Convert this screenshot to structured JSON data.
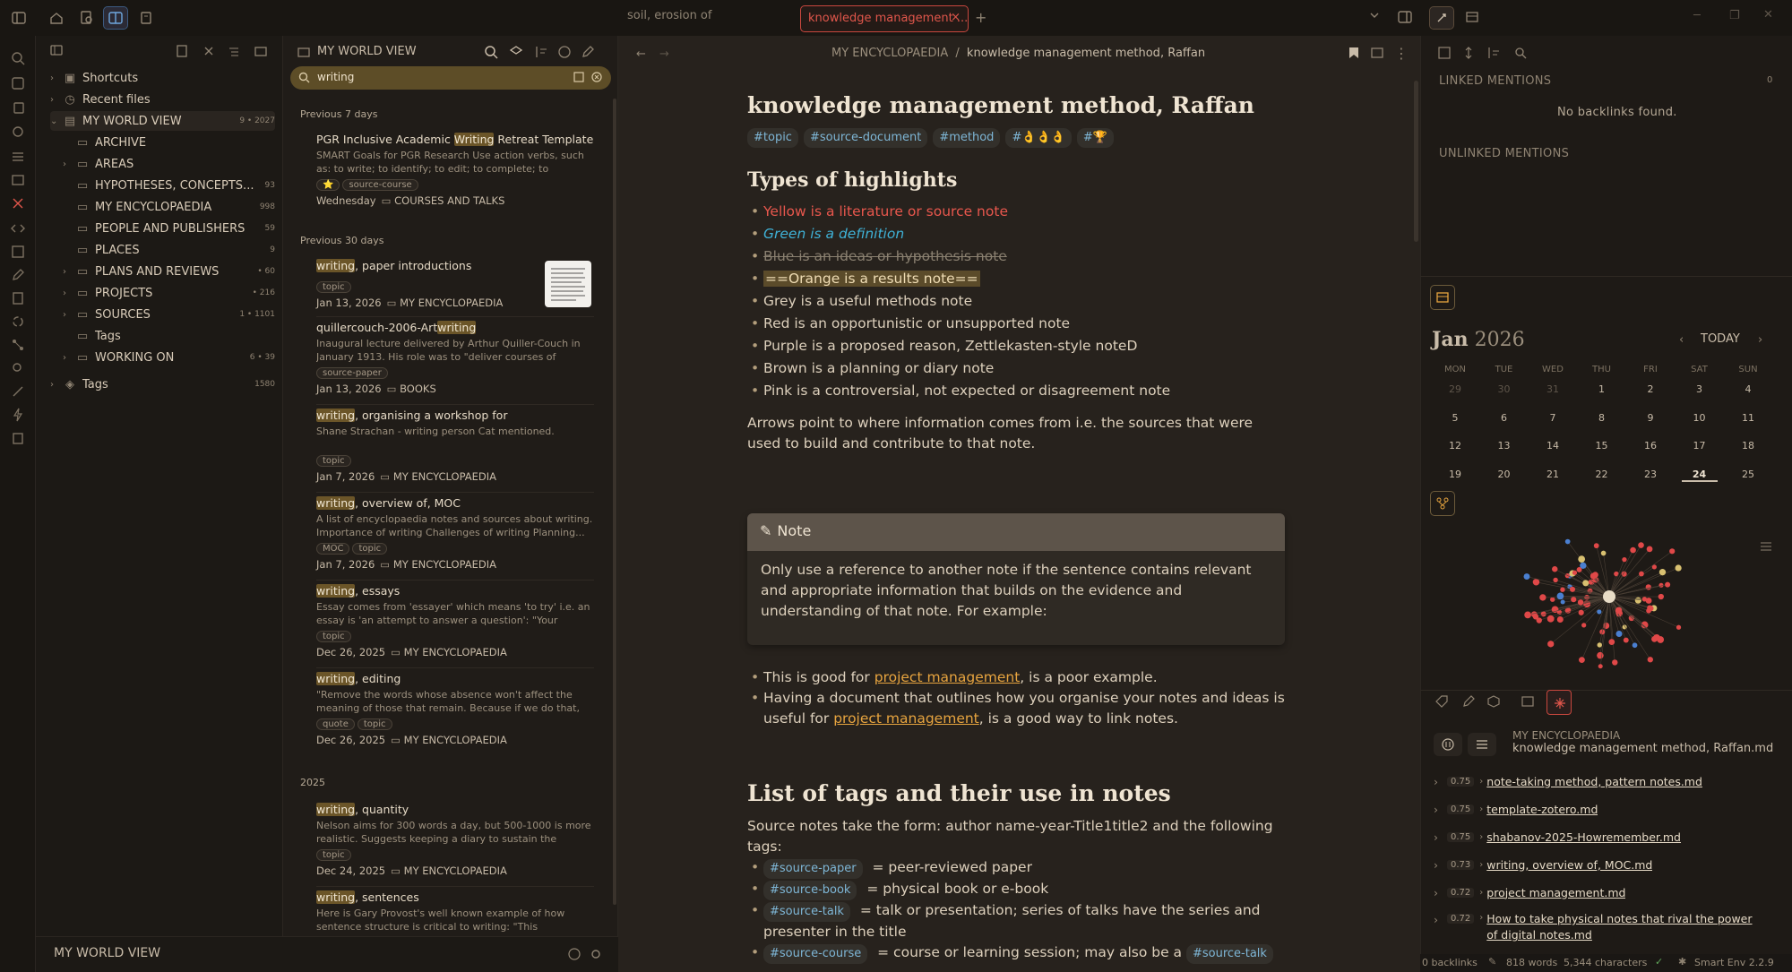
{
  "tabs": [
    {
      "label": "soil, erosion of",
      "active": false
    },
    {
      "label": "knowledge management ...",
      "active": true
    }
  ],
  "sidebar": {
    "items": [
      {
        "label": "Shortcuts",
        "count": ""
      },
      {
        "label": "Recent files",
        "count": ""
      },
      {
        "label": "MY WORLD VIEW",
        "count": "9 • 2027"
      },
      {
        "label": "ARCHIVE",
        "count": ""
      },
      {
        "label": "AREAS",
        "count": ""
      },
      {
        "label": "HYPOTHESES, CONCEPTS...",
        "count": "93"
      },
      {
        "label": "MY ENCYCLOPAEDIA",
        "count": "998"
      },
      {
        "label": "PEOPLE AND PUBLISHERS",
        "count": "59"
      },
      {
        "label": "PLACES",
        "count": "9"
      },
      {
        "label": "PLANS AND REVIEWS",
        "count": "• 60"
      },
      {
        "label": "PROJECTS",
        "count": "• 216"
      },
      {
        "label": "SOURCES",
        "count": "1 • 1101"
      },
      {
        "label": "Tags",
        "count": ""
      },
      {
        "label": "WORKING ON",
        "count": "6 • 39"
      },
      {
        "label": "Tags",
        "count": "1580"
      }
    ],
    "footer": "MY WORLD VIEW"
  },
  "search": {
    "header": "MY WORLD VIEW",
    "query": "writing",
    "groups": [
      "Previous 7 days",
      "Previous 30 days",
      "2025"
    ],
    "results": [
      {
        "pre": "PGR Inclusive Academic ",
        "hl": "Writing",
        "post": " Retreat Template",
        "snippet": "SMART Goals for PGR Research Use action verbs, such as: to write; to identify; to edit; to complete; to presen...",
        "tags": [
          "⭐",
          "source-course"
        ],
        "date": "Wednesday",
        "loc": "COURSES AND TALKS"
      },
      {
        "pre": "",
        "hl": "writing",
        "post": ", paper introductions",
        "snippet": "",
        "tags": [
          "topic"
        ],
        "date": "Jan 13, 2026",
        "loc": "MY ENCYCLOPAEDIA"
      },
      {
        "pre": "quillercouch-2006-Art",
        "hl": "writing",
        "post": "",
        "snippet": "Inaugural lecture delivered by Arthur Quiller-Couch in January 1913. His role was to \"deliver courses of lecture...",
        "tags": [
          "source-paper"
        ],
        "date": "Jan 13, 2026",
        "loc": "BOOKS"
      },
      {
        "pre": "",
        "hl": "writing",
        "post": ", organising a workshop for",
        "snippet": "Shane Strachan - writing person Cat mentioned.",
        "tags": [
          "topic"
        ],
        "date": "Jan 7, 2026",
        "loc": "MY ENCYCLOPAEDIA"
      },
      {
        "pre": "",
        "hl": "writing",
        "post": ", overview of, MOC",
        "snippet": "A list of encyclopaedia notes and sources about writing. Importance of writing Challenges of writing Planning...",
        "tags": [
          "MOC",
          "topic"
        ],
        "date": "Jan 7, 2026",
        "loc": "MY ENCYCLOPAEDIA"
      },
      {
        "pre": "",
        "hl": "writing",
        "post": ", essays",
        "snippet": "Essay comes from 'essayer' which means 'to try' i.e. an essay is 'an attempt to answer a question': \"Your attem...",
        "tags": [
          "topic"
        ],
        "date": "Dec 26, 2025",
        "loc": "MY ENCYCLOPAEDIA"
      },
      {
        "pre": "",
        "hl": "writing",
        "post": ", editing",
        "snippet": "\"Remove the words whose absence won't affect the meaning of those that remain. Because if we do that, t...",
        "tags": [
          "quote",
          "topic"
        ],
        "date": "Dec 26, 2025",
        "loc": "MY ENCYCLOPAEDIA"
      },
      {
        "pre": "",
        "hl": "writing",
        "post": ", quantity",
        "snippet": "Nelson aims for 300 words a day, but 500-1000 is more realistic. Suggests keeping a diary to sustain the writing...",
        "tags": [
          "topic"
        ],
        "date": "Dec 24, 2025",
        "loc": "MY ENCYCLOPAEDIA"
      },
      {
        "pre": "",
        "hl": "writing",
        "post": ", sentences",
        "snippet": "Here is Gary Provost's well known example of how sentence structure is critical to writing: \"This sentence...",
        "tags": [],
        "date": "",
        "loc": ""
      }
    ]
  },
  "editor": {
    "crumb_folder": "MY ENCYCLOPAEDIA",
    "crumb_sep": "/",
    "crumb_note": "knowledge management method, Raffan",
    "title": "knowledge management method, Raffan",
    "tags": [
      "#topic",
      "#source-document",
      "#method",
      "#👌👌👌",
      "#🏆"
    ],
    "h_highlights": "Types of highlights",
    "highlights": [
      "Yellow is a literature or source note",
      "Green is a definition",
      "Blue is an ideas or hypothesis note",
      "==Orange is a results note==",
      "Grey is a useful methods note",
      "Red is an opportunistic or unsupported note",
      "Purple is a proposed reason, Zettlekasten-style noteD",
      "Brown is a planning or diary note",
      "Pink is a controversial, not expected or disagreement note"
    ],
    "arrows_text": "Arrows point to where information comes from i.e. the sources that were used to build and contribute to that note.",
    "callout_title": "Note",
    "callout_body": "Only use a reference to another note if the sentence contains relevant and appropriate information that builds on the evidence and understanding of that note. For example:",
    "ex1_pre": "This is good for ",
    "ex_link": "project management",
    "ex1_post": ", is a poor example.",
    "ex2_pre": "Having a document that outlines how you organise your notes and ideas is useful for ",
    "ex2_post": ", is a good way to link notes.",
    "h_tags": "List of tags and their use in notes",
    "tags_intro": "Source notes take the form: author name-year-Title1title2 and the following tags:",
    "tag_list": [
      {
        "tag": "#source-paper",
        "desc": " = peer-reviewed paper",
        "extra_tag": ""
      },
      {
        "tag": "#source-book",
        "desc": " = physical book or e-book",
        "extra_tag": ""
      },
      {
        "tag": "#source-talk",
        "desc": " = talk or presentation; series of talks have the series and presenter in the title",
        "extra_tag": ""
      },
      {
        "tag": "#source-course",
        "desc": " = course or learning session; may also be a ",
        "extra_tag": "#source-talk"
      }
    ]
  },
  "right": {
    "linked": "LINKED MENTIONS",
    "linked_count": "0",
    "no_backlinks": "No backlinks found.",
    "unlinked": "UNLINKED MENTIONS",
    "cal_month": "Jan",
    "cal_year": "2026",
    "today": "TODAY",
    "dow": [
      "MON",
      "TUE",
      "WED",
      "THU",
      "FRI",
      "SAT",
      "SUN"
    ],
    "weeks": [
      [
        "29",
        "30",
        "31",
        "1",
        "2",
        "3",
        "4"
      ],
      [
        "5",
        "6",
        "7",
        "8",
        "9",
        "10",
        "11"
      ],
      [
        "12",
        "13",
        "14",
        "15",
        "16",
        "17",
        "18"
      ],
      [
        "19",
        "20",
        "21",
        "22",
        "23",
        "24",
        "25"
      ]
    ],
    "sc_folder": "MY ENCYCLOPAEDIA",
    "sc_note": "knowledge management method, Raffan.md",
    "connections": [
      {
        "score": "0.75",
        "name": "note-taking method, pattern notes.md"
      },
      {
        "score": "0.75",
        "name": "template-zotero.md"
      },
      {
        "score": "0.75",
        "name": "shabanov-2025-Howremember.md"
      },
      {
        "score": "0.73",
        "name": "writing, overview of, MOC.md"
      },
      {
        "score": "0.72",
        "name": "project management.md"
      },
      {
        "score": "0.72",
        "name": "How to take physical notes that rival the power of digital notes.md"
      }
    ]
  },
  "status": {
    "backlinks": "0 backlinks",
    "words": "818 words",
    "chars": "5,344 characters",
    "env": "Smart Env 2.2.9"
  },
  "colors": {
    "accent_red": "#e0564b",
    "link_orange": "#e7a43f",
    "tag_blue": "#7eb6d6",
    "highlight_bg": "#6b5528"
  }
}
